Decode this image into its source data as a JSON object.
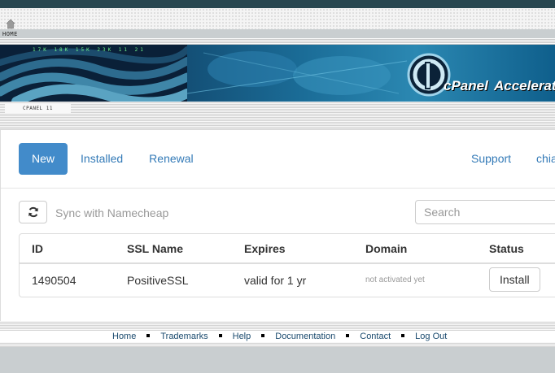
{
  "header": {
    "home_label": "HOME",
    "cpanel_label": "CPANEL 11",
    "brand_cpanel": "cPanel",
    "brand_accelerated": "Accelerated",
    "banner_digits": "17K 18K 15K 23K 11 21"
  },
  "nav": {
    "tabs": [
      {
        "label": "New",
        "active": true
      },
      {
        "label": "Installed"
      },
      {
        "label": "Renewal"
      }
    ],
    "right": [
      {
        "label": "Support"
      },
      {
        "label": "chia"
      }
    ]
  },
  "toolbar": {
    "sync_label": "Sync with Namecheap",
    "search_placeholder": "Search"
  },
  "table": {
    "columns": [
      "ID",
      "SSL Name",
      "Expires",
      "Domain",
      "Status"
    ],
    "rows": [
      {
        "id": "1490504",
        "ssl_name": "PositiveSSL",
        "expires": "valid for 1 yr",
        "domain": "not activated yet",
        "status_button": "Install"
      }
    ]
  },
  "footer": {
    "links": [
      "Home",
      "Trademarks",
      "Help",
      "Documentation",
      "Contact",
      "Log Out"
    ]
  },
  "colors": {
    "accent": "#428bca",
    "link": "#337ab7",
    "topbar": "#27464f"
  }
}
